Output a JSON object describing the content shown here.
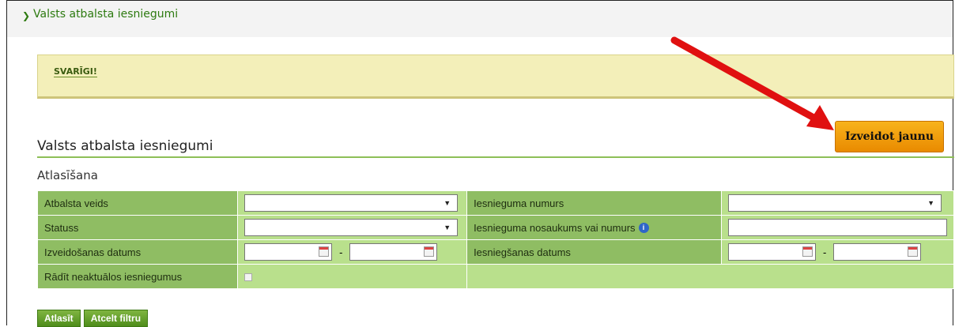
{
  "section": {
    "title": "Valsts atbalsta iesniegumi"
  },
  "notice": {
    "label": "SVARĪGI!"
  },
  "main": {
    "heading": "Valsts atbalsta iesniegumi",
    "create_button": "Izveidot jaunu",
    "filter_title": "Atlasīšana"
  },
  "filters": {
    "support_type_label": "Atbalsta veids",
    "application_number_label": "Iesnieguma numurs",
    "status_label": "Statuss",
    "name_or_number_label": "Iesnieguma nosaukums vai numurs",
    "created_date_label": "Izveidošanas datums",
    "submitted_date_label": "Iesniegšanas datums",
    "show_inactive_label": "Rādīt neaktuālos iesniegumus",
    "date_separator": "-"
  },
  "actions": {
    "filter_button": "Atlasīt",
    "cancel_filter_button": "Atcelt filtru"
  },
  "colors": {
    "accent_green": "#8dbf57",
    "orange_button": "#f39c0a",
    "annotation_arrow": "#e01010"
  }
}
